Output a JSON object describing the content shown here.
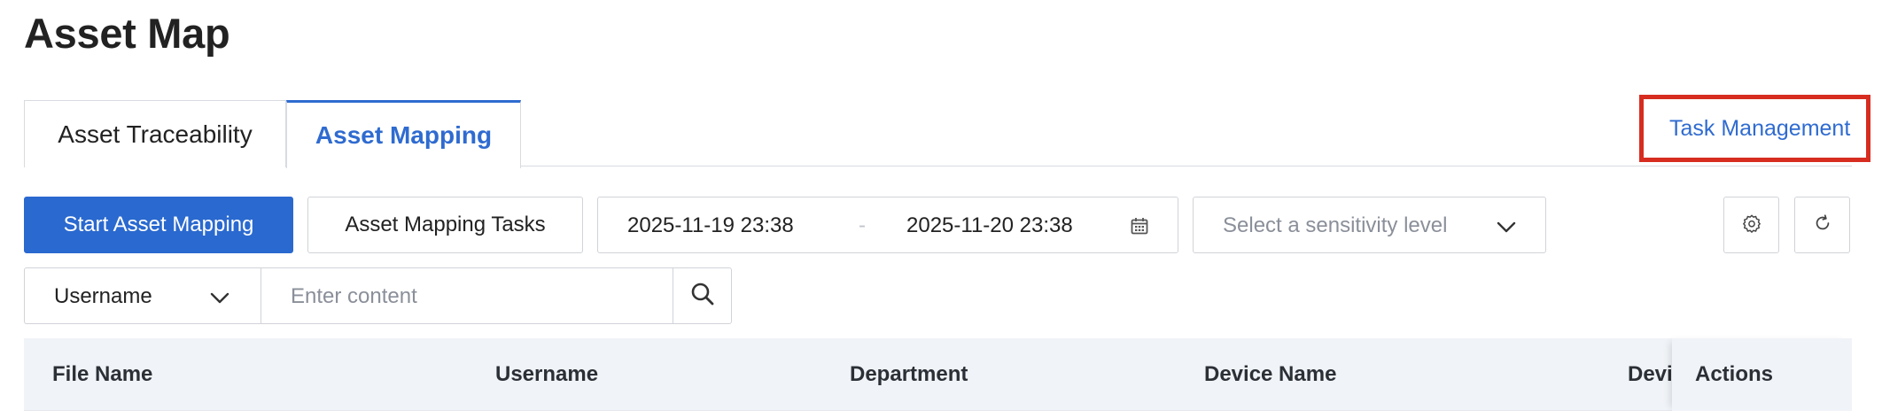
{
  "page": {
    "title": "Asset Map"
  },
  "tabs": [
    {
      "label": "Asset Traceability",
      "active": false
    },
    {
      "label": "Asset Mapping",
      "active": true
    }
  ],
  "task_management": {
    "label": "Task Management",
    "highlighted": true,
    "highlight_color": "#d62d20"
  },
  "toolbar": {
    "start_label": "Start Asset Mapping",
    "tasks_label": "Asset Mapping Tasks",
    "date_range": {
      "start": "2025-11-19 23:38",
      "separator": "-",
      "end": "2025-11-20 23:38",
      "icon": "calendar-icon"
    },
    "sensitivity_placeholder": "Select a sensitivity level",
    "settings_icon": "gear-icon",
    "refresh_icon": "refresh-icon"
  },
  "search": {
    "field": "Username",
    "placeholder": "Enter content",
    "icon": "search-icon"
  },
  "table": {
    "columns": [
      "File Name",
      "Username",
      "Department",
      "Device Name",
      "Devi",
      "Actions"
    ]
  },
  "colors": {
    "accent": "#2f6bd0",
    "primary_button": "#2a69cf",
    "header_bg": "#f0f3f7"
  }
}
